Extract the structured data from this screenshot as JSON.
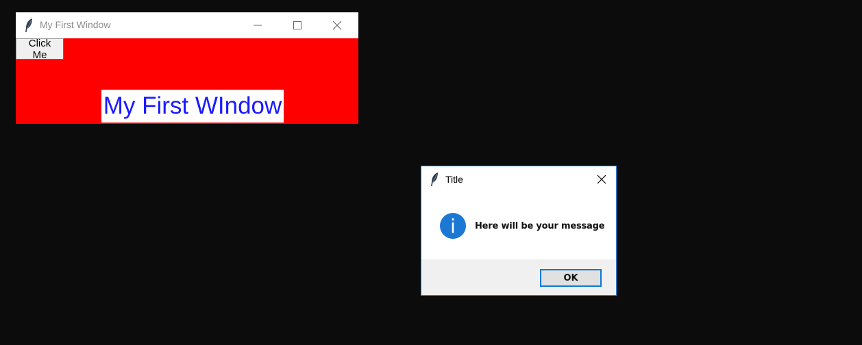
{
  "main_window": {
    "title": "My First Window",
    "button_label": "Click Me",
    "label_text": "My First WIndow",
    "background_color": "#ff0000",
    "label_text_color": "#1a1aff",
    "icon": "feather-icon"
  },
  "dialog": {
    "title": "Title",
    "message": "Here will be your message",
    "ok_label": "OK",
    "message_icon": "info-icon",
    "info_glyph": "i",
    "accent_color": "#1b78d4"
  }
}
